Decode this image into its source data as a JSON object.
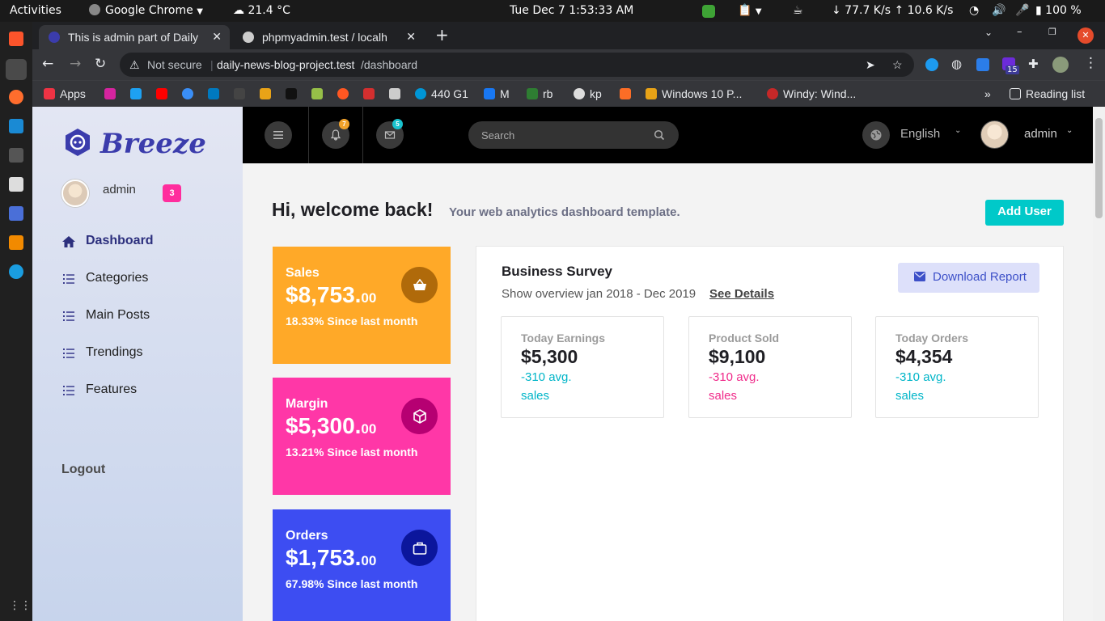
{
  "os_bar": {
    "activities": "Activities",
    "app_name": "Google Chrome",
    "weather": "21.4 °C",
    "clock": "Tue Dec 7   1:53:33 AM",
    "network_speed": "↓ 77.7 K/s ↑ 10.6 K/s",
    "battery": "100 %"
  },
  "browser": {
    "tabs": [
      {
        "title": "This is admin part of Daily",
        "active": true
      },
      {
        "title": "phpmyadmin.test / localh",
        "active": false
      }
    ],
    "url_warning": "Not secure",
    "url_domain": "daily-news-blog-project.test",
    "url_path": "/dashboard",
    "extension_badge": "15",
    "bookmarks": [
      "Apps",
      "440 G1",
      "M",
      "rb",
      "kp",
      "Windows 10 P...",
      "Windy: Wind..."
    ],
    "reading_list": "Reading list"
  },
  "sidebar": {
    "brand": "Breeze",
    "user_name": "admin",
    "notification_count": "3",
    "items": [
      {
        "label": "Dashboard",
        "active": true
      },
      {
        "label": "Categories"
      },
      {
        "label": "Main Posts"
      },
      {
        "label": "Trendings"
      },
      {
        "label": "Features"
      }
    ],
    "logout": "Logout"
  },
  "topbar": {
    "bell_count": "7",
    "mail_count": "5",
    "search_placeholder": "Search",
    "language": "English",
    "user_name": "admin"
  },
  "header": {
    "title": "Hi, welcome back!",
    "subtitle": "Your web analytics dashboard template.",
    "add_user": "Add User"
  },
  "stats": [
    {
      "title": "Sales",
      "value": "$8,753.",
      "cents": "00",
      "note": "18.33% Since last month",
      "color": "#ffa928",
      "icon_color": "#b06a0a"
    },
    {
      "title": "Margin",
      "value": "$5,300.",
      "cents": "00",
      "note": "13.21% Since last month",
      "color": "#ff37a7",
      "icon_color": "#b60072"
    },
    {
      "title": "Orders",
      "value": "$1,753.",
      "cents": "00",
      "note": "67.98% Since last month",
      "color": "#3d4df2",
      "icon_color": "#0b169c"
    }
  ],
  "survey": {
    "title": "Business Survey",
    "subtitle": "Show overview jan 2018 - Dec 2019",
    "details_link": "See Details",
    "download_label": "Download Report",
    "metrics": [
      {
        "label": "Today Earnings",
        "value": "$5,300",
        "change": "-310 avg.",
        "unit": "sales",
        "color": "#00b5c8"
      },
      {
        "label": "Product Sold",
        "value": "$9,100",
        "change": "-310 avg.",
        "unit": "sales",
        "color": "#f02b8a"
      },
      {
        "label": "Today Orders",
        "value": "$4,354",
        "change": "-310 avg.",
        "unit": "sales",
        "color": "#00b5c8"
      }
    ]
  }
}
